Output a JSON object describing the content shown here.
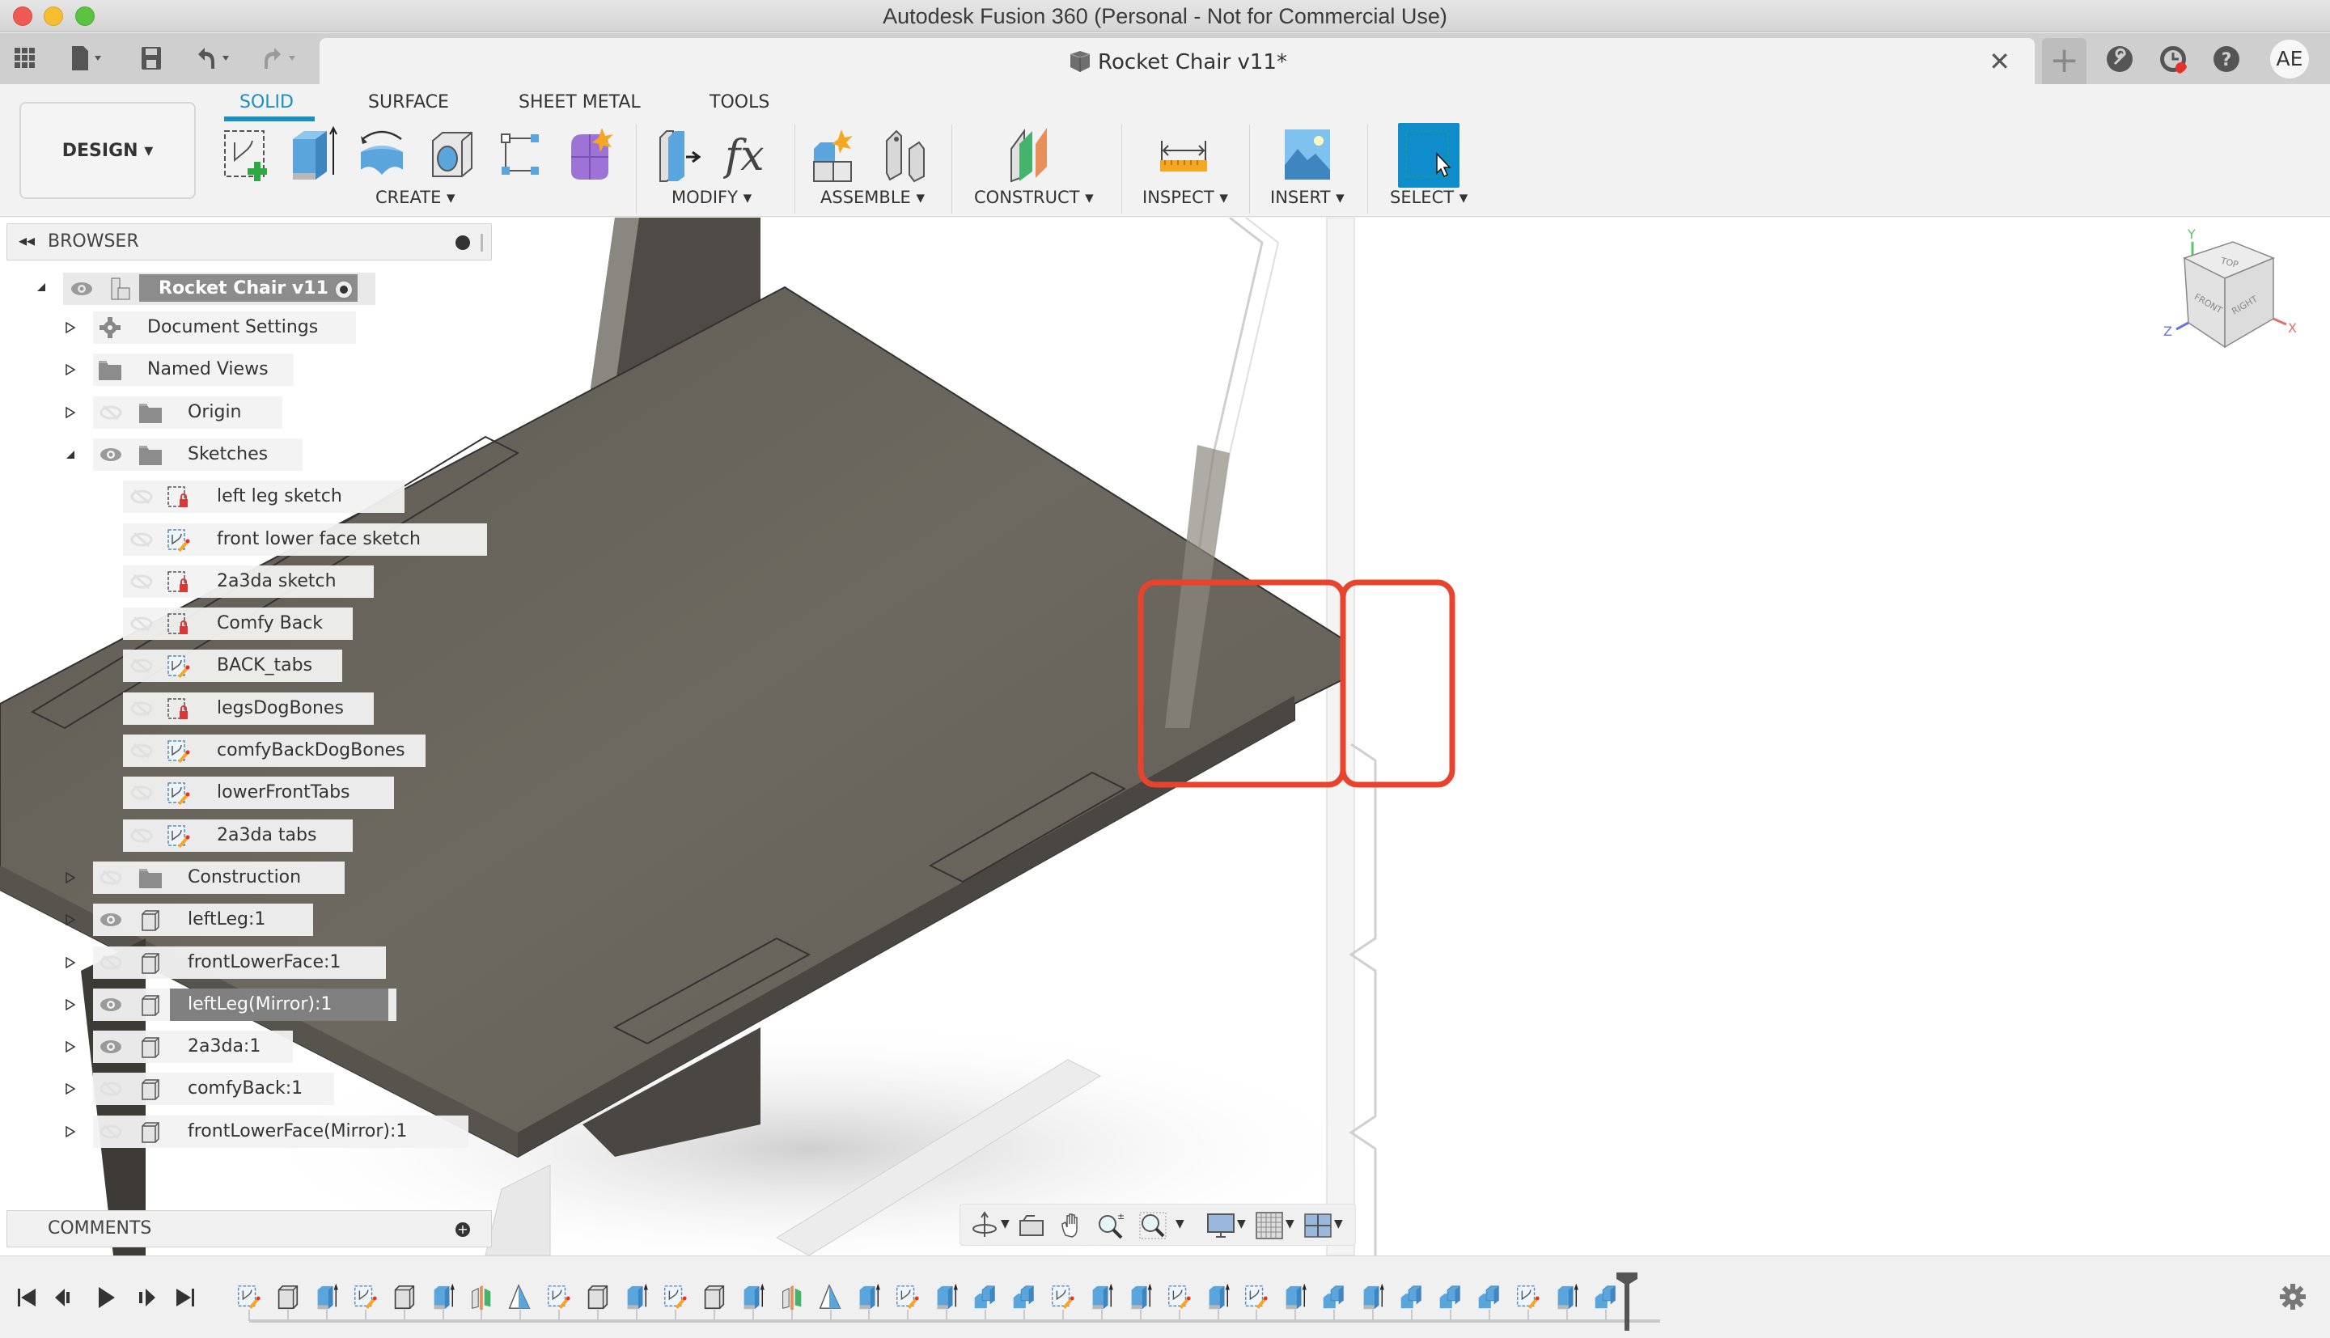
{
  "window": {
    "title": "Autodesk Fusion 360 (Personal - Not for Commercial Use)",
    "controls": [
      "close",
      "minimize",
      "maximize"
    ]
  },
  "tabstrip": {
    "quick_access": [
      {
        "name": "data-panel",
        "icon": "grid-icon"
      },
      {
        "name": "file-menu",
        "icon": "file-icon"
      },
      {
        "name": "save",
        "icon": "save-icon"
      },
      {
        "name": "undo",
        "icon": "undo-icon"
      },
      {
        "name": "redo",
        "icon": "redo-icon"
      }
    ],
    "document_tab": {
      "title": "Rocket Chair v11*",
      "close_glyph": "✕"
    },
    "new_tab_glyph": "+",
    "right_icons": [
      "extensions-icon",
      "job-status-icon",
      "help-icon"
    ],
    "user_initials": "AE"
  },
  "toolbar": {
    "workspace": "DESIGN ▾",
    "tabs": [
      {
        "label": "SOLID",
        "active": true
      },
      {
        "label": "SURFACE",
        "active": false
      },
      {
        "label": "SHEET METAL",
        "active": false
      },
      {
        "label": "TOOLS",
        "active": false
      }
    ],
    "groups": [
      {
        "label": "CREATE ▾",
        "tools": [
          "create-sketch",
          "extrude",
          "revolve",
          "hole",
          "pattern",
          "create-form"
        ]
      },
      {
        "label": "MODIFY ▾",
        "tools": [
          "press-pull",
          "change-parameters"
        ]
      },
      {
        "label": "ASSEMBLE ▾",
        "tools": [
          "new-component",
          "joint"
        ]
      },
      {
        "label": "CONSTRUCT ▾",
        "tools": [
          "offset-plane"
        ]
      },
      {
        "label": "INSPECT ▾",
        "tools": [
          "measure"
        ]
      },
      {
        "label": "INSERT ▾",
        "tools": [
          "insert-canvas"
        ]
      },
      {
        "label": "SELECT ▾",
        "tools": [
          "select"
        ]
      }
    ],
    "accent_color": "#1a8fc2"
  },
  "browser": {
    "title": "BROWSER",
    "root": {
      "label": "Rocket Chair v11",
      "visible": true
    },
    "items": [
      {
        "label": "Document Settings",
        "level": 1,
        "expander": "collapsed",
        "icon": "gear",
        "eye": "none"
      },
      {
        "label": "Named Views",
        "level": 1,
        "expander": "collapsed",
        "icon": "folder",
        "eye": "none"
      },
      {
        "label": "Origin",
        "level": 1,
        "expander": "collapsed",
        "icon": "folder",
        "eye": "hidden"
      },
      {
        "label": "Sketches",
        "level": 1,
        "expander": "expanded",
        "icon": "folder",
        "eye": "visible"
      },
      {
        "label": "left leg sketch",
        "level": 2,
        "icon": "sketch-locked",
        "eye": "hidden"
      },
      {
        "label": "front lower face sketch",
        "level": 2,
        "icon": "sketch-edit",
        "eye": "hidden"
      },
      {
        "label": "2a3da sketch",
        "level": 2,
        "icon": "sketch-locked",
        "eye": "hidden"
      },
      {
        "label": "Comfy Back",
        "level": 2,
        "icon": "sketch-locked",
        "eye": "hidden"
      },
      {
        "label": "BACK_tabs",
        "level": 2,
        "icon": "sketch-edit",
        "eye": "hidden"
      },
      {
        "label": "legsDogBones",
        "level": 2,
        "icon": "sketch-locked",
        "eye": "hidden"
      },
      {
        "label": "comfyBackDogBones",
        "level": 2,
        "icon": "sketch-edit",
        "eye": "hidden"
      },
      {
        "label": "lowerFrontTabs",
        "level": 2,
        "icon": "sketch-edit",
        "eye": "hidden"
      },
      {
        "label": "2a3da tabs",
        "level": 2,
        "icon": "sketch-edit",
        "eye": "hidden"
      },
      {
        "label": "Construction",
        "level": 1,
        "expander": "collapsed",
        "icon": "folder",
        "eye": "hidden"
      },
      {
        "label": "leftLeg:1",
        "level": 1,
        "expander": "collapsed",
        "icon": "component",
        "eye": "visible"
      },
      {
        "label": "frontLowerFace:1",
        "level": 1,
        "expander": "collapsed",
        "icon": "component",
        "eye": "hidden"
      },
      {
        "label": "leftLeg(Mirror):1",
        "level": 1,
        "expander": "collapsed",
        "icon": "component",
        "eye": "visible",
        "selected": true
      },
      {
        "label": "2a3da:1",
        "level": 1,
        "expander": "collapsed",
        "icon": "component",
        "eye": "visible"
      },
      {
        "label": "comfyBack:1",
        "level": 1,
        "expander": "collapsed",
        "icon": "component",
        "eye": "hidden"
      },
      {
        "label": "frontLowerFace(Mirror):1",
        "level": 1,
        "expander": "collapsed",
        "icon": "component",
        "eye": "hidden"
      }
    ]
  },
  "comments": {
    "title": "COMMENTS"
  },
  "viewcube": {
    "faces": [
      "TOP",
      "FRONT",
      "RIGHT"
    ],
    "axes": [
      "Y",
      "Z",
      "X"
    ]
  },
  "navbar": {
    "tools": [
      "orbit-icon",
      "look-at-icon",
      "pan-icon",
      "zoom-icon",
      "fit-icon",
      "display-settings-icon",
      "grid-icon",
      "viewports-icon"
    ]
  },
  "timeline": {
    "controls": [
      "first-icon",
      "previous-icon",
      "play-icon",
      "next-icon",
      "last-icon"
    ],
    "features": [
      "sketch",
      "component",
      "extrude",
      "sketch",
      "component",
      "extrude",
      "mirror",
      "plane",
      "sketch",
      "component",
      "extrude",
      "sketch",
      "component",
      "extrude",
      "mirror",
      "plane",
      "extrude",
      "sketch",
      "extrude",
      "combine",
      "combine",
      "sketch",
      "extrude",
      "extrude",
      "sketch",
      "extrude",
      "sketch",
      "extrude",
      "combine",
      "extrude",
      "combine",
      "combine",
      "combine",
      "sketch",
      "extrude",
      "combine"
    ]
  },
  "annotations": {
    "highlight_color": "#e8432c",
    "highlight_boxes": 2
  }
}
